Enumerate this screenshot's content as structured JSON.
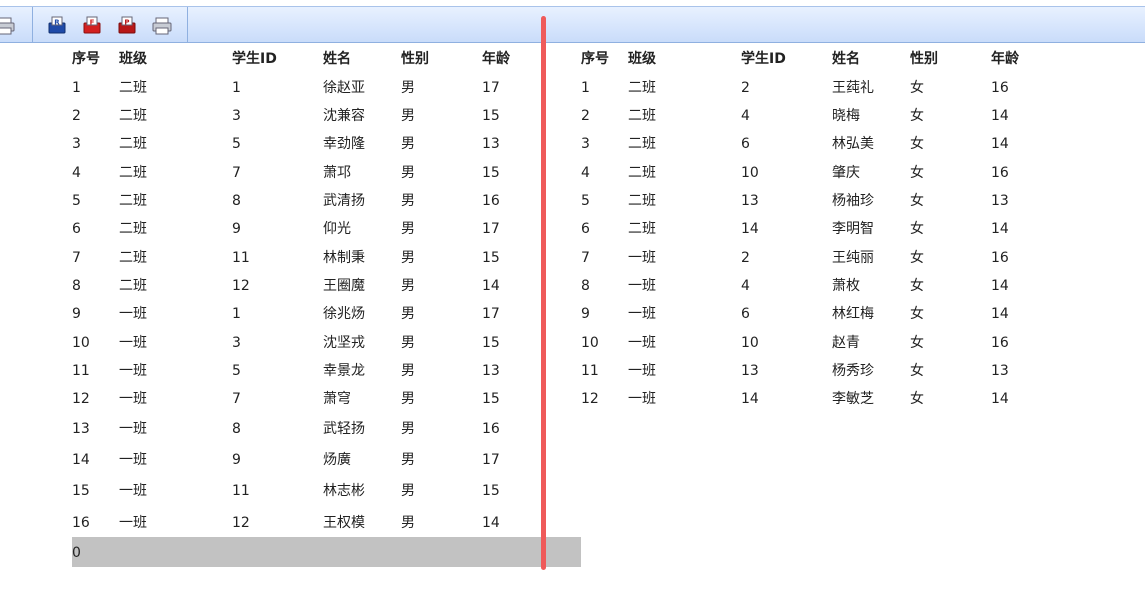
{
  "toolbar": {
    "buttons": [
      {
        "icon": "print-icon"
      },
      {
        "icon": "export-r-icon",
        "letter": "R"
      },
      {
        "icon": "export-f-icon",
        "letter": "F"
      },
      {
        "icon": "export-p-icon",
        "letter": "P"
      },
      {
        "icon": "print-icon"
      }
    ]
  },
  "left": {
    "headers": [
      "序号",
      "班级",
      "学生ID",
      "姓名",
      "性别",
      "年龄"
    ],
    "rows": [
      [
        "1",
        "二班",
        "1",
        "徐赵亚",
        "男",
        "17"
      ],
      [
        "2",
        "二班",
        "3",
        "沈兼容",
        "男",
        "15"
      ],
      [
        "3",
        "二班",
        "5",
        "幸劲隆",
        "男",
        "13"
      ],
      [
        "4",
        "二班",
        "7",
        "萧邛",
        "男",
        "15"
      ],
      [
        "5",
        "二班",
        "8",
        "武清扬",
        "男",
        "16"
      ],
      [
        "6",
        "二班",
        "9",
        "仰光",
        "男",
        "17"
      ],
      [
        "7",
        "二班",
        "11",
        "林制秉",
        "男",
        "15"
      ],
      [
        "8",
        "二班",
        "12",
        "王圈魔",
        "男",
        "14"
      ],
      [
        "9",
        "一班",
        "1",
        "徐兆炀",
        "男",
        "17"
      ],
      [
        "10",
        "一班",
        "3",
        "沈坚戎",
        "男",
        "15"
      ],
      [
        "11",
        "一班",
        "5",
        "幸景龙",
        "男",
        "13"
      ],
      [
        "12",
        "一班",
        "7",
        "萧穹",
        "男",
        "15"
      ],
      [
        "13",
        "一班",
        "8",
        "武轻扬",
        "男",
        "16"
      ],
      [
        "14",
        "一班",
        "9",
        "炀廣",
        "男",
        "17"
      ],
      [
        "15",
        "一班",
        "11",
        "林志彬",
        "男",
        "15"
      ],
      [
        "16",
        "一班",
        "12",
        "王权模",
        "男",
        "14"
      ]
    ],
    "footer": "0"
  },
  "right": {
    "headers": [
      "序号",
      "班级",
      "学生ID",
      "姓名",
      "性别",
      "年龄"
    ],
    "rows": [
      [
        "1",
        "二班",
        "2",
        "王莼礼",
        "女",
        "16"
      ],
      [
        "2",
        "二班",
        "4",
        "晓梅",
        "女",
        "14"
      ],
      [
        "3",
        "二班",
        "6",
        "林弘美",
        "女",
        "14"
      ],
      [
        "4",
        "二班",
        "10",
        "肇庆",
        "女",
        "16"
      ],
      [
        "5",
        "二班",
        "13",
        "杨袖珍",
        "女",
        "13"
      ],
      [
        "6",
        "二班",
        "14",
        "李明智",
        "女",
        "14"
      ],
      [
        "7",
        "一班",
        "2",
        "王纯丽",
        "女",
        "16"
      ],
      [
        "8",
        "一班",
        "4",
        "萧枚",
        "女",
        "14"
      ],
      [
        "9",
        "一班",
        "6",
        "林红梅",
        "女",
        "14"
      ],
      [
        "10",
        "一班",
        "10",
        "赵青",
        "女",
        "16"
      ],
      [
        "11",
        "一班",
        "13",
        "杨秀珍",
        "女",
        "13"
      ],
      [
        "12",
        "一班",
        "14",
        "李敏芝",
        "女",
        "14"
      ]
    ]
  },
  "colors": {
    "splitter": "#ef5a5a",
    "footer_bg": "#c2c2c2",
    "toolbar_bg": "#c9dcfa"
  }
}
